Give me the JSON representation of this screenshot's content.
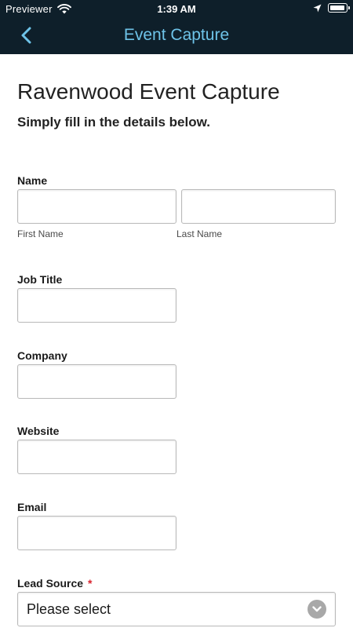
{
  "status_bar": {
    "carrier": "Previewer",
    "time": "1:39 AM",
    "battery_level": 0.95
  },
  "nav": {
    "back_icon": "chevron-left-icon",
    "title": "Event Capture"
  },
  "form": {
    "title": "Ravenwood Event Capture",
    "subtitle": "Simply fill in the details below.",
    "name": {
      "label": "Name",
      "first_name_label": "First Name",
      "first_name_value": "",
      "last_name_label": "Last Name",
      "last_name_value": ""
    },
    "job_title": {
      "label": "Job Title",
      "value": ""
    },
    "company": {
      "label": "Company",
      "value": ""
    },
    "website": {
      "label": "Website",
      "value": ""
    },
    "email": {
      "label": "Email",
      "value": ""
    },
    "lead_source": {
      "label": "Lead Source",
      "required_marker": "*",
      "selected": "Please select"
    }
  },
  "colors": {
    "header_bg": "#0e1f2a",
    "nav_accent": "#6ec3e8",
    "required": "#d9232e"
  }
}
